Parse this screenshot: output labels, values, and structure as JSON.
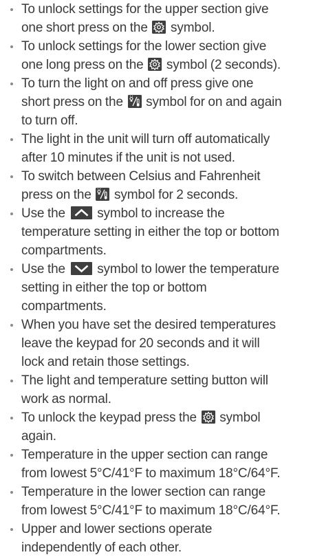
{
  "colors": {
    "text": "#3a3a3a",
    "bullet": "#8a8a8a",
    "icon_bg": "#3f3f3f",
    "icon_fg": "#ffffff"
  },
  "icons": {
    "settings": "gear-icon",
    "light_temp": "light-thermometer-icon",
    "up": "chevron-up-icon",
    "down": "chevron-down-icon"
  },
  "items": [
    {
      "l1": "To unlock settings for the upper section give",
      "l2a": "one short press on the",
      "l2b": "symbol."
    },
    {
      "l1": "To unlock settings for the lower section give",
      "l2a": "one long press on the",
      "l2b": "symbol (2 seconds)."
    },
    {
      "l1": "To turn the light on and off press give one",
      "l2a": "short press on the",
      "l2b": "symbol for on and again",
      "l3": "to turn off."
    },
    {
      "l1": "The light in the unit will turn off automatically",
      "l2": "after 10 minutes if the unit is not used."
    },
    {
      "l1": "To switch between Celsius and Fahrenheit",
      "l2a": "press on the",
      "l2b": "symbol for 2 seconds."
    },
    {
      "l1a": "Use the",
      "l1b": "symbol to increase the",
      "l2": "temperature setting in either the top or bottom",
      "l3": "compartments."
    },
    {
      "l1a": "Use the",
      "l1b": "symbol to lower the temperature",
      "l2": "setting in either the top or bottom",
      "l3": "compartments."
    },
    {
      "l1": "When you have set the desired temperatures",
      "l2": "leave the keypad for 20 seconds and it will",
      "l3": "lock and retain those settings."
    },
    {
      "l1": "The light and temperature setting button will",
      "l2": "work as normal."
    },
    {
      "l1a": "To unlock the keypad press the",
      "l1b": "symbol",
      "l2": "again."
    },
    {
      "l1": "Temperature in the upper section can range",
      "l2": "from lowest 5°C/41°F to maximum 18°C/64°F."
    },
    {
      "l1": "Temperature in the lower section can range",
      "l2": "from lowest 5°C/41°F to maximum 18°C/64°F."
    },
    {
      "l1": "Upper and lower sections operate",
      "l2": "independently of each other."
    }
  ]
}
